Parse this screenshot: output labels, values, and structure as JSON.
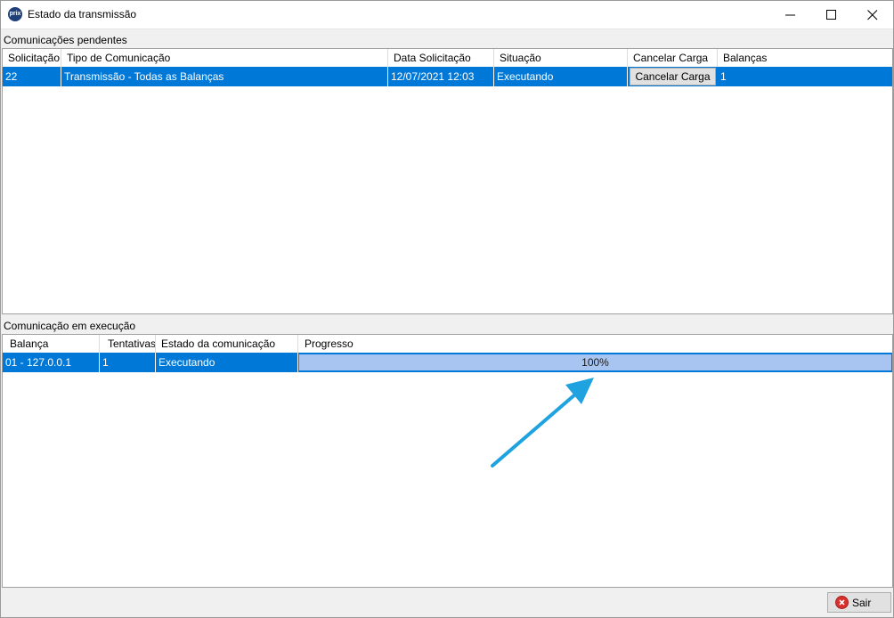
{
  "window": {
    "title": "Estado da transmissão",
    "icon_text": "prix",
    "controls": [
      "minimize-icon",
      "maximize-icon",
      "close-icon"
    ]
  },
  "pending": {
    "label": "Comunicações pendentes",
    "columns": [
      "Solicitação",
      "Tipo de Comunicação",
      "Data Solicitação",
      "Situação",
      "Cancelar Carga",
      "Balanças"
    ],
    "rows": [
      {
        "solicitacao": "22",
        "tipo": "Transmissão - Todas as Balanças",
        "data": "12/07/2021 12:03",
        "situacao": "Executando",
        "cancelar_label": "Cancelar Carga",
        "balancas": "1"
      }
    ]
  },
  "executing": {
    "label": "Comunicação em execução",
    "columns": [
      "Balança",
      "Tentativas",
      "Estado da comunicação",
      "Progresso"
    ],
    "rows": [
      {
        "balanca": "01 - 127.0.0.1",
        "tentativas": "1",
        "estado": "Executando",
        "progress_text": "100%",
        "progress_fraction": 1.0
      }
    ]
  },
  "footer": {
    "exit_label": "Sair"
  },
  "colors": {
    "selection": "#0078d7",
    "progress_fill": "#a8c4f0",
    "annotation_arrow": "#1fa3e0",
    "exit_icon": "#d9302c"
  }
}
